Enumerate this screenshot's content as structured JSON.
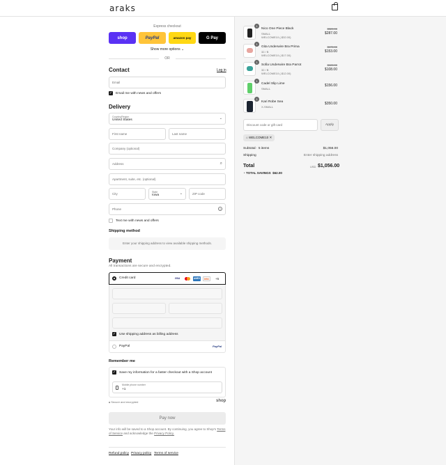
{
  "header": {
    "logo": "araks"
  },
  "express": {
    "title": "Express checkout",
    "shop": "shop",
    "paypal": "PayPal",
    "amazon": "amazon pay",
    "gpay": "G Pay",
    "more": "Show more options",
    "or": "OR"
  },
  "contact": {
    "title": "Contact",
    "login": "Log in",
    "email_placeholder": "Email",
    "news": "Email me with news and offers"
  },
  "delivery": {
    "title": "Delivery",
    "country_label": "Country/Region",
    "country": "United States",
    "first": "First name",
    "last": "Last name",
    "company": "Company (optional)",
    "address": "Address",
    "apartment": "Apartment, suite, etc. (optional)",
    "city": "City",
    "state_label": "State",
    "state": "Iowa",
    "zip": "ZIP code",
    "phone": "Phone",
    "text_news": "Text me with news and offers"
  },
  "shipping": {
    "title": "Shipping method",
    "note": "Enter your shipping address to view available shipping methods."
  },
  "payment": {
    "title": "Payment",
    "subtitle": "All transactions are secure and encrypted.",
    "credit": "Credit card",
    "more_cards": "+5",
    "billing": "Use shipping address as billing address",
    "paypal": "PayPal",
    "paypal_logo": "PayPal"
  },
  "remember": {
    "title": "Remember me",
    "save": "Save my information for a faster checkout with a Shop account",
    "mobile_label": "Mobile phone number",
    "mobile_value": "+1",
    "secure": "Secure and encrypted",
    "shop": "shop"
  },
  "paynow": "Pay now",
  "legal": {
    "text": "Your info will be saved to a Shop account. By continuing, you agree to Shop's",
    "terms": "Terms of Service",
    "and": "and acknowledge the",
    "privacy": "Privacy Policy."
  },
  "footer": {
    "refund": "Refund policy",
    "privacy": "Privacy policy",
    "terms": "Terms of service"
  },
  "cart": {
    "items": [
      {
        "qty": "1",
        "name": "Nico One Piece Black",
        "variant": "SMALL",
        "discount": "WELCOME10 (-$32.00)",
        "old": "$320.00",
        "price": "$287.00",
        "color": "#222"
      },
      {
        "qty": "1",
        "name": "Gita Underwire Bra Prima",
        "variant": "32 / B",
        "discount": "WELCOME10 (-$17.00)",
        "old": "$170.00",
        "price": "$153.00",
        "color": "#e8a6a0"
      },
      {
        "qty": "1",
        "name": "Sofia Underwire Bra Parrot",
        "variant": "32 / B",
        "discount": "WELCOME10 (-$12.00)",
        "old": "$120.00",
        "price": "$108.00",
        "color": "#3aa39a"
      },
      {
        "qty": "1",
        "name": "Cadel Slip Lime",
        "variant": "SMALL",
        "discount": "",
        "old": "",
        "price": "$156.00",
        "color": "#5fcf6a"
      },
      {
        "qty": "1",
        "name": "Kari Robe Sea",
        "variant": "X-SMALL",
        "discount": "",
        "old": "",
        "price": "$350.00",
        "color": "#1c2431"
      }
    ],
    "discount_placeholder": "Discount code or gift card",
    "apply": "Apply",
    "code": "WELCOME10",
    "subtotal_label": "Subtotal · 5 items",
    "subtotal": "$1,056.00",
    "shipping_label": "Shipping",
    "shipping": "Enter shipping address",
    "total_label": "Total",
    "currency": "USD",
    "total": "$1,056.00",
    "savings_label": "TOTAL SAVINGS",
    "savings": "$62.00"
  }
}
